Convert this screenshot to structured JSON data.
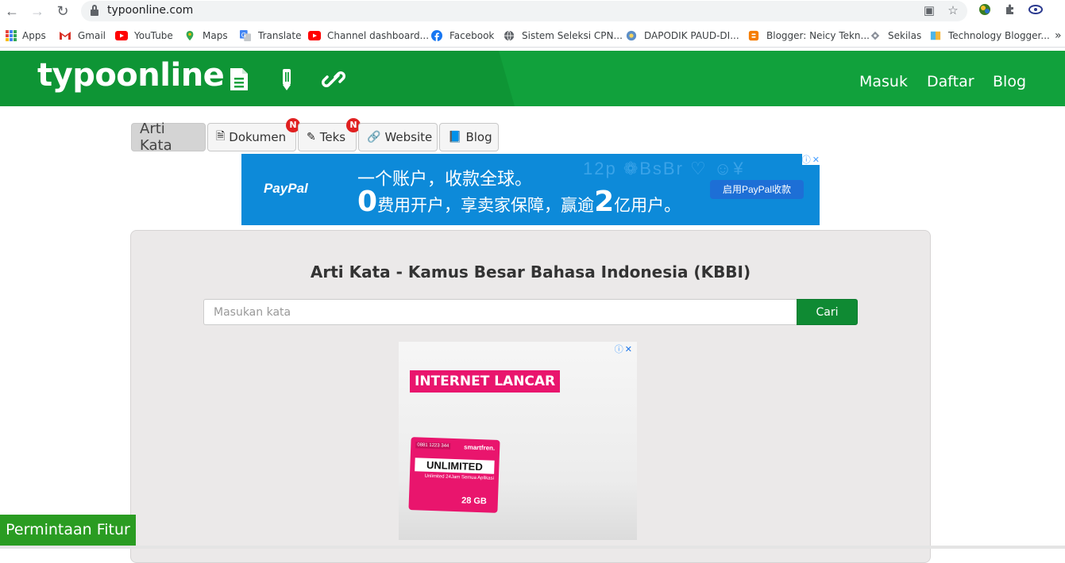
{
  "browser": {
    "url": "typoonline.com",
    "bookmarks": [
      {
        "label": "Apps",
        "icon": "apps-grid-icon"
      },
      {
        "label": "Gmail",
        "icon": "gmail-icon"
      },
      {
        "label": "YouTube",
        "icon": "youtube-icon"
      },
      {
        "label": "Maps",
        "icon": "maps-icon"
      },
      {
        "label": "Translate",
        "icon": "translate-icon"
      },
      {
        "label": "Channel dashboard...",
        "icon": "youtube-icon"
      },
      {
        "label": "Facebook",
        "icon": "facebook-icon"
      },
      {
        "label": "Sistem Seleksi CPN...",
        "icon": "globe-icon"
      },
      {
        "label": "DAPODIK PAUD-DI...",
        "icon": "dapodik-icon"
      },
      {
        "label": "Blogger: Neicy Tekn...",
        "icon": "blogger-icon"
      },
      {
        "label": "Sekilas",
        "icon": "sekilas-icon"
      },
      {
        "label": "Technology Blogger...",
        "icon": "book-icon"
      }
    ],
    "more": "»"
  },
  "site": {
    "logo": "typoonline",
    "nav": {
      "login": "Masuk",
      "register": "Daftar",
      "blog": "Blog"
    }
  },
  "tabs": [
    {
      "label": "Arti Kata",
      "icon": "",
      "active": true,
      "badge": ""
    },
    {
      "label": "Dokumen",
      "icon": "file-icon",
      "active": false,
      "badge": "N"
    },
    {
      "label": "Teks",
      "icon": "pencil-icon",
      "active": false,
      "badge": "N"
    },
    {
      "label": "Website",
      "icon": "link-icon",
      "active": false,
      "badge": ""
    },
    {
      "label": "Blog",
      "icon": "book-icon",
      "active": false,
      "badge": ""
    }
  ],
  "ad_top": {
    "brand": "PayPal",
    "line1": "一个账户，收款全球。",
    "line2_big1": "0",
    "line2_a": "费用开户，享卖家保障，赢逾",
    "line2_big2": "2",
    "line2_b": "亿用户。",
    "cta": "启用PayPal收款",
    "bg_text": "12p ❁BsBr ♡ ☺¥"
  },
  "main": {
    "title": "Arti Kata - Kamus Besar Bahasa Indonesia (KBBI)",
    "search_placeholder": "Masukan kata",
    "search_button": "Cari"
  },
  "ad_box": {
    "headline": "INTERNET LANCAR",
    "product_number": "0881 1223 344",
    "product_brand": "smartfren.",
    "product_title": "UNLIMITED",
    "product_sub": "Unlimited 24Jam Semua Aplikasi",
    "product_size": "28 GB"
  },
  "feature_request": "Permintaan Fitur",
  "colors": {
    "brand_green": "#11a13c",
    "button_green": "#0f8a33",
    "badge_red": "#e02020",
    "paypal_blue": "#0d8ad9",
    "ad_pink": "#e9156d"
  }
}
